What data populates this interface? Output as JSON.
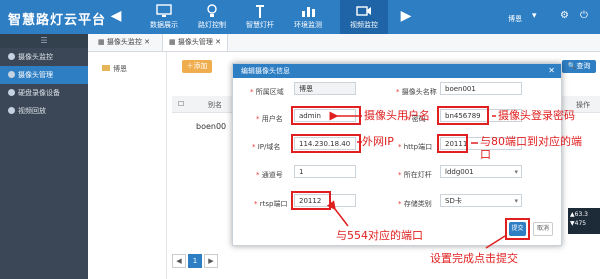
{
  "app": {
    "title": "智慧路灯云平台",
    "user": "博恩"
  },
  "nav": [
    {
      "label": "数据展示",
      "icon": "monitor-icon"
    },
    {
      "label": "路灯控制",
      "icon": "lamp-icon"
    },
    {
      "label": "智慧灯杆",
      "icon": "pole-icon"
    },
    {
      "label": "环境监测",
      "icon": "chart-icon"
    },
    {
      "label": "视频监控",
      "icon": "camera-icon"
    }
  ],
  "sidebar": {
    "items": [
      {
        "label": "摄像头监控"
      },
      {
        "label": "摄像头管理"
      },
      {
        "label": "硬盘录像设备"
      },
      {
        "label": "视频回放"
      }
    ]
  },
  "tabs": [
    {
      "label": "摄像头监控"
    },
    {
      "label": "摄像头管理"
    }
  ],
  "toolbar": {
    "add_label": "添加",
    "query_label": "查询"
  },
  "tree": {
    "root": "博恩"
  },
  "table": {
    "col_alias": "别名",
    "col_action": "操作",
    "row1_alias": "boen00"
  },
  "modal": {
    "title": "编辑摄像头信息",
    "submit_label": "提交",
    "cancel_label": "取消",
    "fields": {
      "region": {
        "label": "所属区域",
        "value": "博恩"
      },
      "camera_name": {
        "label": "摄像头名称",
        "value": "boen001"
      },
      "username": {
        "label": "用户名",
        "value": "admin"
      },
      "password": {
        "label": "密码",
        "value": "bn456789"
      },
      "ip": {
        "label": "IP/域名",
        "value": "114.230.18.40"
      },
      "http_port": {
        "label": "http端口",
        "value": "20111"
      },
      "channel": {
        "label": "通道号",
        "value": "1"
      },
      "lamp_pole": {
        "label": "所在灯杆",
        "value": "lddg001"
      },
      "rtsp_port": {
        "label": "rtsp端口",
        "value": "20112"
      },
      "storage": {
        "label": "存储类别",
        "value": "SD卡"
      }
    }
  },
  "annotations": {
    "username": "摄像头用户名",
    "password": "摄像头登录密码",
    "ip": "外网IP",
    "http_port": "与80端口到对应的端口",
    "rtsp_port": "与554对应的端口",
    "submit": "设置完成点击提交"
  },
  "stats": {
    "up": "63.3",
    "down": "475"
  },
  "colors": {
    "primary": "#2e7ec4",
    "sidebar": "#3b4756",
    "annotation": "#e02020",
    "add": "#f0ad4e"
  }
}
